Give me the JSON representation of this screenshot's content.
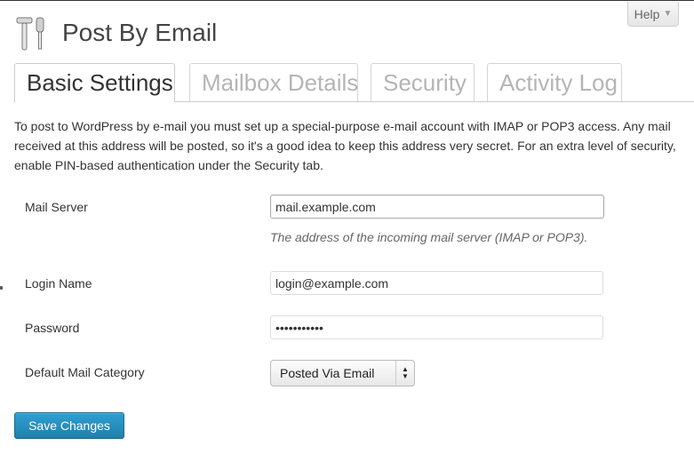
{
  "header": {
    "help_label": "Help",
    "title": "Post By Email",
    "icon": "tools-icon"
  },
  "tabs": [
    {
      "label": "Basic Settings",
      "active": true
    },
    {
      "label": "Mailbox Details",
      "active": false
    },
    {
      "label": "Security",
      "active": false
    },
    {
      "label": "Activity Log",
      "active": false
    }
  ],
  "intro": "To post to WordPress by e-mail you must set up a special-purpose e-mail account with IMAP or POP3 access. Any mail received at this address will be posted, so it's a good idea to keep this address very secret. For an extra level of security, enable PIN-based authentication under the Security tab.",
  "form": {
    "mail_server": {
      "label": "Mail Server",
      "value": "mail.example.com",
      "description": "The address of the incoming mail server (IMAP or POP3)."
    },
    "login_name": {
      "label": "Login Name",
      "value": "login@example.com"
    },
    "password": {
      "label": "Password",
      "value": "•••••••••••"
    },
    "default_category": {
      "label": "Default Mail Category",
      "selected": "Posted Via Email"
    }
  },
  "save_label": "Save Changes",
  "colors": {
    "primary_button": "#2a8fbf",
    "tab_inactive_text": "#b5b5b5"
  }
}
